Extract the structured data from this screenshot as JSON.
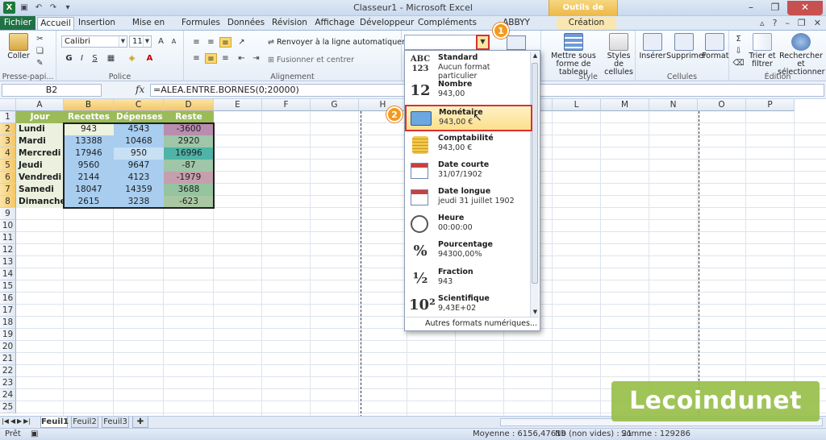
{
  "window": {
    "title": "Classeur1 - Microsoft Excel",
    "context_tools": "Outils de tableau"
  },
  "tabs": [
    {
      "label": "Fichier"
    },
    {
      "label": "Accueil"
    },
    {
      "label": "Insertion"
    },
    {
      "label": "Mise en page"
    },
    {
      "label": "Formules"
    },
    {
      "label": "Données"
    },
    {
      "label": "Révision"
    },
    {
      "label": "Affichage"
    },
    {
      "label": "Développeur"
    },
    {
      "label": "Compléments"
    },
    {
      "label": "ABBYY FineReader 12"
    },
    {
      "label": "Création"
    }
  ],
  "ribbon": {
    "clipboard": {
      "paste": "Coller",
      "label": "Presse-papi..."
    },
    "font": {
      "name": "Calibri",
      "size": "11",
      "bold": "G",
      "italic": "I",
      "underline": "S",
      "label": "Police"
    },
    "alignment": {
      "wrap": "Renvoyer à la ligne automatiquement",
      "merge": "Fusionner et centrer",
      "label": "Alignement"
    },
    "style": {
      "format_table": "Mettre sous forme de tableau",
      "cell_styles": "Styles de cellules",
      "label": "Style"
    },
    "cells": {
      "insert": "Insérer",
      "delete": "Supprimer",
      "format": "Format",
      "label": "Cellules"
    },
    "editing": {
      "sort": "Trier et filtrer",
      "find": "Rechercher et sélectionner",
      "label": "Édition"
    }
  },
  "callouts": [
    "1",
    "2"
  ],
  "formula_bar": {
    "name_box": "B2",
    "fx": "fx",
    "formula": "=ALEA.ENTRE.BORNES(0;20000)"
  },
  "columns": [
    "A",
    "B",
    "C",
    "D",
    "E",
    "F",
    "G",
    "H",
    "I",
    "J",
    "K",
    "L",
    "M",
    "N",
    "O",
    "P"
  ],
  "rows": [
    "1",
    "2",
    "3",
    "4",
    "5",
    "6",
    "7",
    "8",
    "9",
    "10",
    "11",
    "12",
    "13",
    "14",
    "15",
    "16",
    "17",
    "18",
    "19",
    "20",
    "21",
    "22",
    "23",
    "24",
    "25"
  ],
  "table": {
    "headers": [
      "Jour",
      "Recettes",
      "Dépenses",
      "Reste"
    ],
    "rows": [
      [
        "Lundi",
        "943",
        "4543",
        "-3600"
      ],
      [
        "Mardi",
        "13388",
        "10468",
        "2920"
      ],
      [
        "Mercredi",
        "17946",
        "950",
        "16996"
      ],
      [
        "Jeudi",
        "9560",
        "9647",
        "-87"
      ],
      [
        "Vendredi",
        "2144",
        "4123",
        "-1979"
      ],
      [
        "Samedi",
        "18047",
        "14359",
        "3688"
      ],
      [
        "Dimanche",
        "2615",
        "3238",
        "-623"
      ]
    ],
    "reste_colors": [
      "#b98db0",
      "#9fc6a8",
      "#4fb3a6",
      "#9fc6a8",
      "#c69fae",
      "#94c4a0",
      "#a9c7a3"
    ],
    "b_colors": [
      "#eef3df",
      "#a8cdef",
      "#a8cdef",
      "#a8cdef",
      "#a8cdef",
      "#a8cdef",
      "#a8cdef"
    ],
    "c_colors": [
      "#a8cdef",
      "#a8cdef",
      "#c8e0f4",
      "#a8cdef",
      "#a8cdef",
      "#a8cdef",
      "#a8cdef"
    ]
  },
  "number_formats": [
    {
      "icon": "ABC 123",
      "name": "Standard",
      "example": "Aucun format particulier"
    },
    {
      "icon": "12",
      "name": "Nombre",
      "example": "943,00"
    },
    {
      "icon": "money-icon",
      "name": "Monétaire",
      "example": "943,00 €"
    },
    {
      "icon": "coins-icon",
      "name": "Comptabilité",
      "example": " 943,00 €"
    },
    {
      "icon": "calendar-icon",
      "name": "Date courte",
      "example": "31/07/1902"
    },
    {
      "icon": "calendar-icon",
      "name": "Date longue",
      "example": "jeudi 31 juillet 1902"
    },
    {
      "icon": "clock-icon",
      "name": "Heure",
      "example": "00:00:00"
    },
    {
      "icon": "%",
      "name": "Pourcentage",
      "example": "94300,00%"
    },
    {
      "icon": "½",
      "name": "Fraction",
      "example": "943"
    },
    {
      "icon": "10²",
      "name": "Scientifique",
      "example": "9,43E+02"
    }
  ],
  "more_formats": "Autres formats numériques...",
  "sheets": [
    "Feuil1",
    "Feuil2",
    "Feuil3"
  ],
  "status": {
    "ready": "Prêt",
    "average": "Moyenne : 6156,47619",
    "count": "Nb (non vides) : 21",
    "sum": "Somme : 129286"
  },
  "watermark": "Lecoindunet"
}
